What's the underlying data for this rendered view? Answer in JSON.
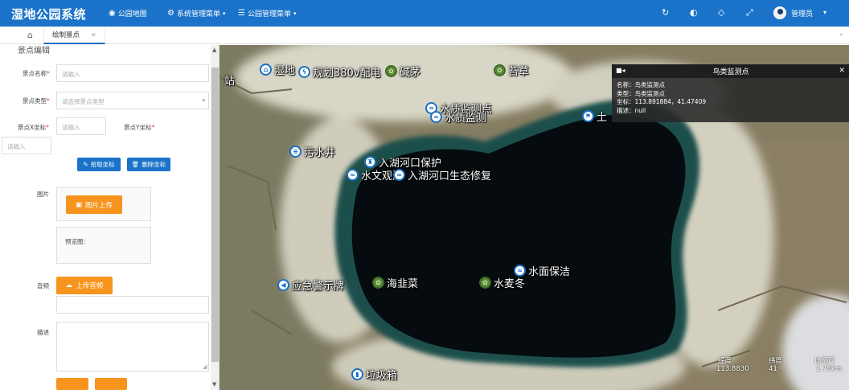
{
  "app": {
    "title": "湿地公园系统",
    "nav": [
      {
        "icon": "globe-icon",
        "label": "公园地图"
      },
      {
        "icon": "gear-icon",
        "label": "系统管理菜单"
      },
      {
        "icon": "sliders-icon",
        "label": "公园管理菜单"
      }
    ],
    "user": "管理员"
  },
  "tabs": {
    "active": "绘制景点"
  },
  "form": {
    "title": "景点编辑",
    "name_label": "景点名称",
    "name_placeholder": "请输入",
    "type_label": "景点类型",
    "type_placeholder": "请选择景点类型",
    "x_label": "景点X坐标",
    "x_placeholder": "请输入",
    "y_label": "景点Y坐标",
    "y_placeholder": "请输入",
    "pick_coord_btn": "拾取坐标",
    "clear_coord_btn": "删除坐标",
    "image_label": "图片",
    "image_upload_btn": "图片上传",
    "preview_label": "预览图：",
    "audio_label": "音频",
    "audio_upload_btn": "上传音频",
    "desc_label": "描述"
  },
  "map": {
    "markers": [
      {
        "label": "湿地",
        "icon": "home"
      },
      {
        "label": "规划380v配电",
        "icon": "lightning"
      },
      {
        "label": "碱茅",
        "icon": "plant"
      },
      {
        "label": "苔草",
        "icon": "plant"
      },
      {
        "label": "站",
        "icon": ""
      },
      {
        "label": "水质监测点",
        "icon": "water"
      },
      {
        "label": "水质监测",
        "icon": "water"
      },
      {
        "label": "土",
        "icon": "cart"
      },
      {
        "label": "污水井",
        "icon": "pipe"
      },
      {
        "label": "入湖河口保护",
        "icon": "shield"
      },
      {
        "label": "水文观测",
        "icon": "water"
      },
      {
        "label": "入湖河口生态修复",
        "icon": "water"
      },
      {
        "label": "水面保洁",
        "icon": "water"
      },
      {
        "label": "应急警示牌",
        "icon": "speaker"
      },
      {
        "label": "海韭菜",
        "icon": "plant"
      },
      {
        "label": "水麦冬",
        "icon": "plant"
      },
      {
        "label": "垃圾箱",
        "icon": "chart"
      }
    ],
    "popup": {
      "title": "鸟类监测点",
      "name_line": "名称：鸟类监测点",
      "type_line": "类型：鸟类监测点",
      "coord_line": "坐标：113.891884，41.47409",
      "desc_line": "描述：null"
    },
    "status": {
      "lng_label": "经度",
      "lng_value": "113.8830",
      "lat_label": "纬度",
      "lat_value": "41",
      "scale_label": "比例尺",
      "scale_value": "1.75km"
    }
  }
}
